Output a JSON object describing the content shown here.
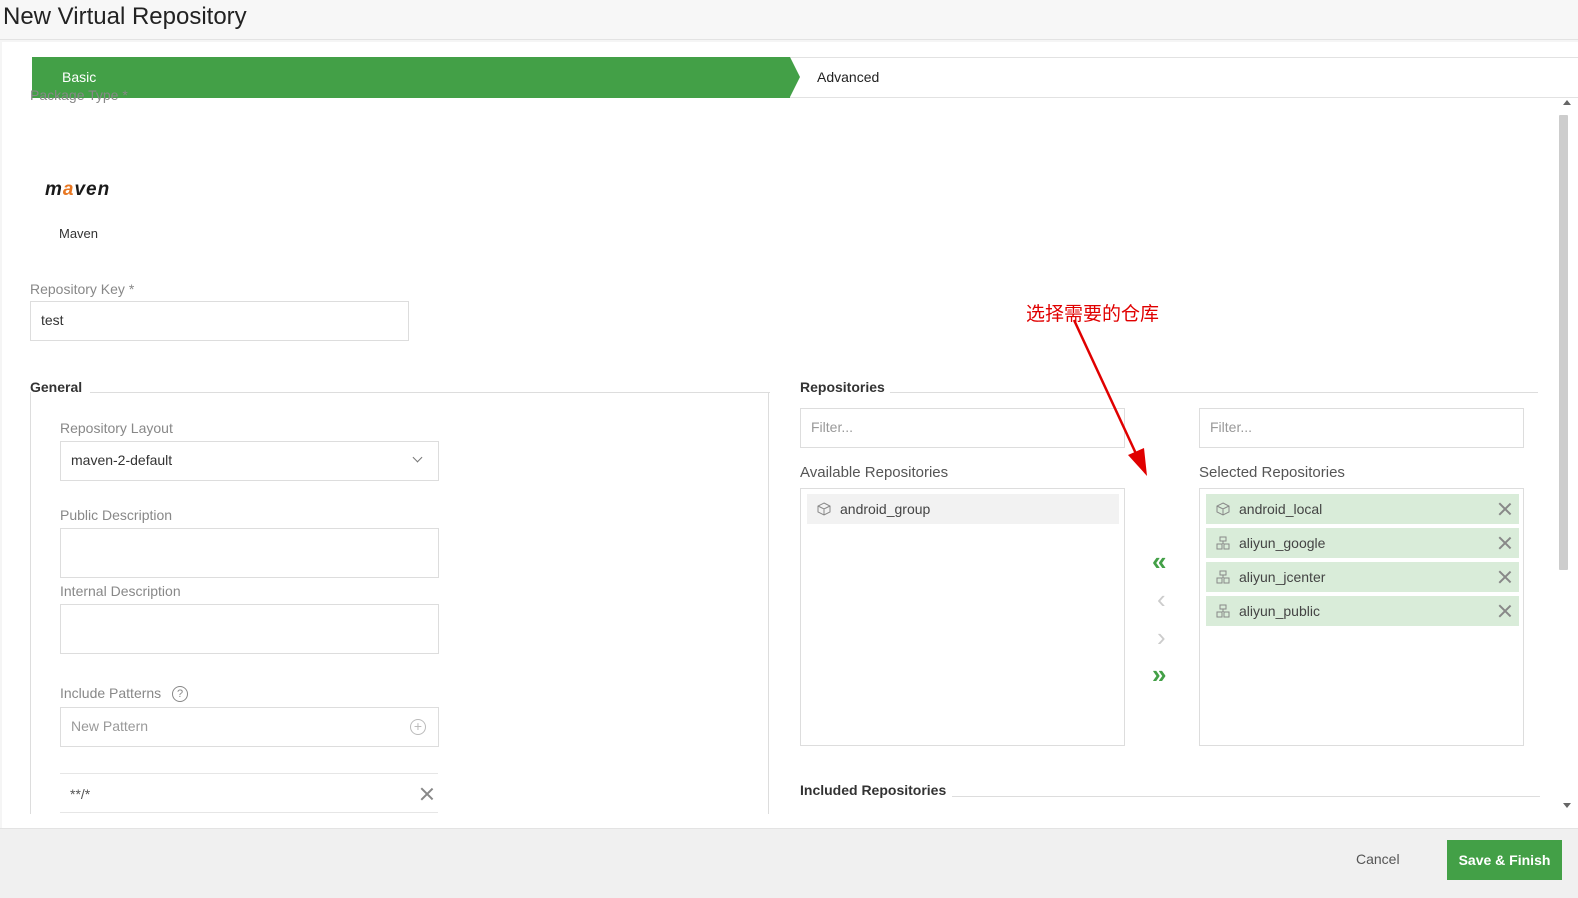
{
  "header": {
    "title": "New Virtual Repository"
  },
  "wizard": {
    "steps": [
      "Basic",
      "Advanced"
    ]
  },
  "package_type": {
    "label": "Package Type *",
    "value": "Maven",
    "logo_text": "maven"
  },
  "repository_key": {
    "label": "Repository Key *",
    "value": "test"
  },
  "general": {
    "title": "General",
    "layout_label": "Repository Layout",
    "layout_value": "maven-2-default",
    "public_desc_label": "Public Description",
    "internal_desc_label": "Internal Description",
    "include_label": "Include Patterns",
    "help_glyph": "?",
    "pattern_placeholder": "New Pattern",
    "pattern_value": "**/*"
  },
  "repositories": {
    "title": "Repositories",
    "filter_placeholder": "Filter...",
    "available_title": "Available Repositories",
    "selected_title": "Selected Repositories",
    "available": [
      "android_group"
    ],
    "selected": [
      "android_local",
      "aliyun_google",
      "aliyun_jcenter",
      "aliyun_public"
    ],
    "included_title": "Included Repositories"
  },
  "transfer": {
    "add_all": "«",
    "add": "‹",
    "remove": "›",
    "remove_all": "»"
  },
  "annotation": {
    "text": "选择需要的仓库",
    "color": "#e00000"
  },
  "footer": {
    "cancel": "Cancel",
    "save": "Save & Finish"
  },
  "colors": {
    "accent": "#43a047",
    "selected_bg": "#d9ecd9"
  }
}
